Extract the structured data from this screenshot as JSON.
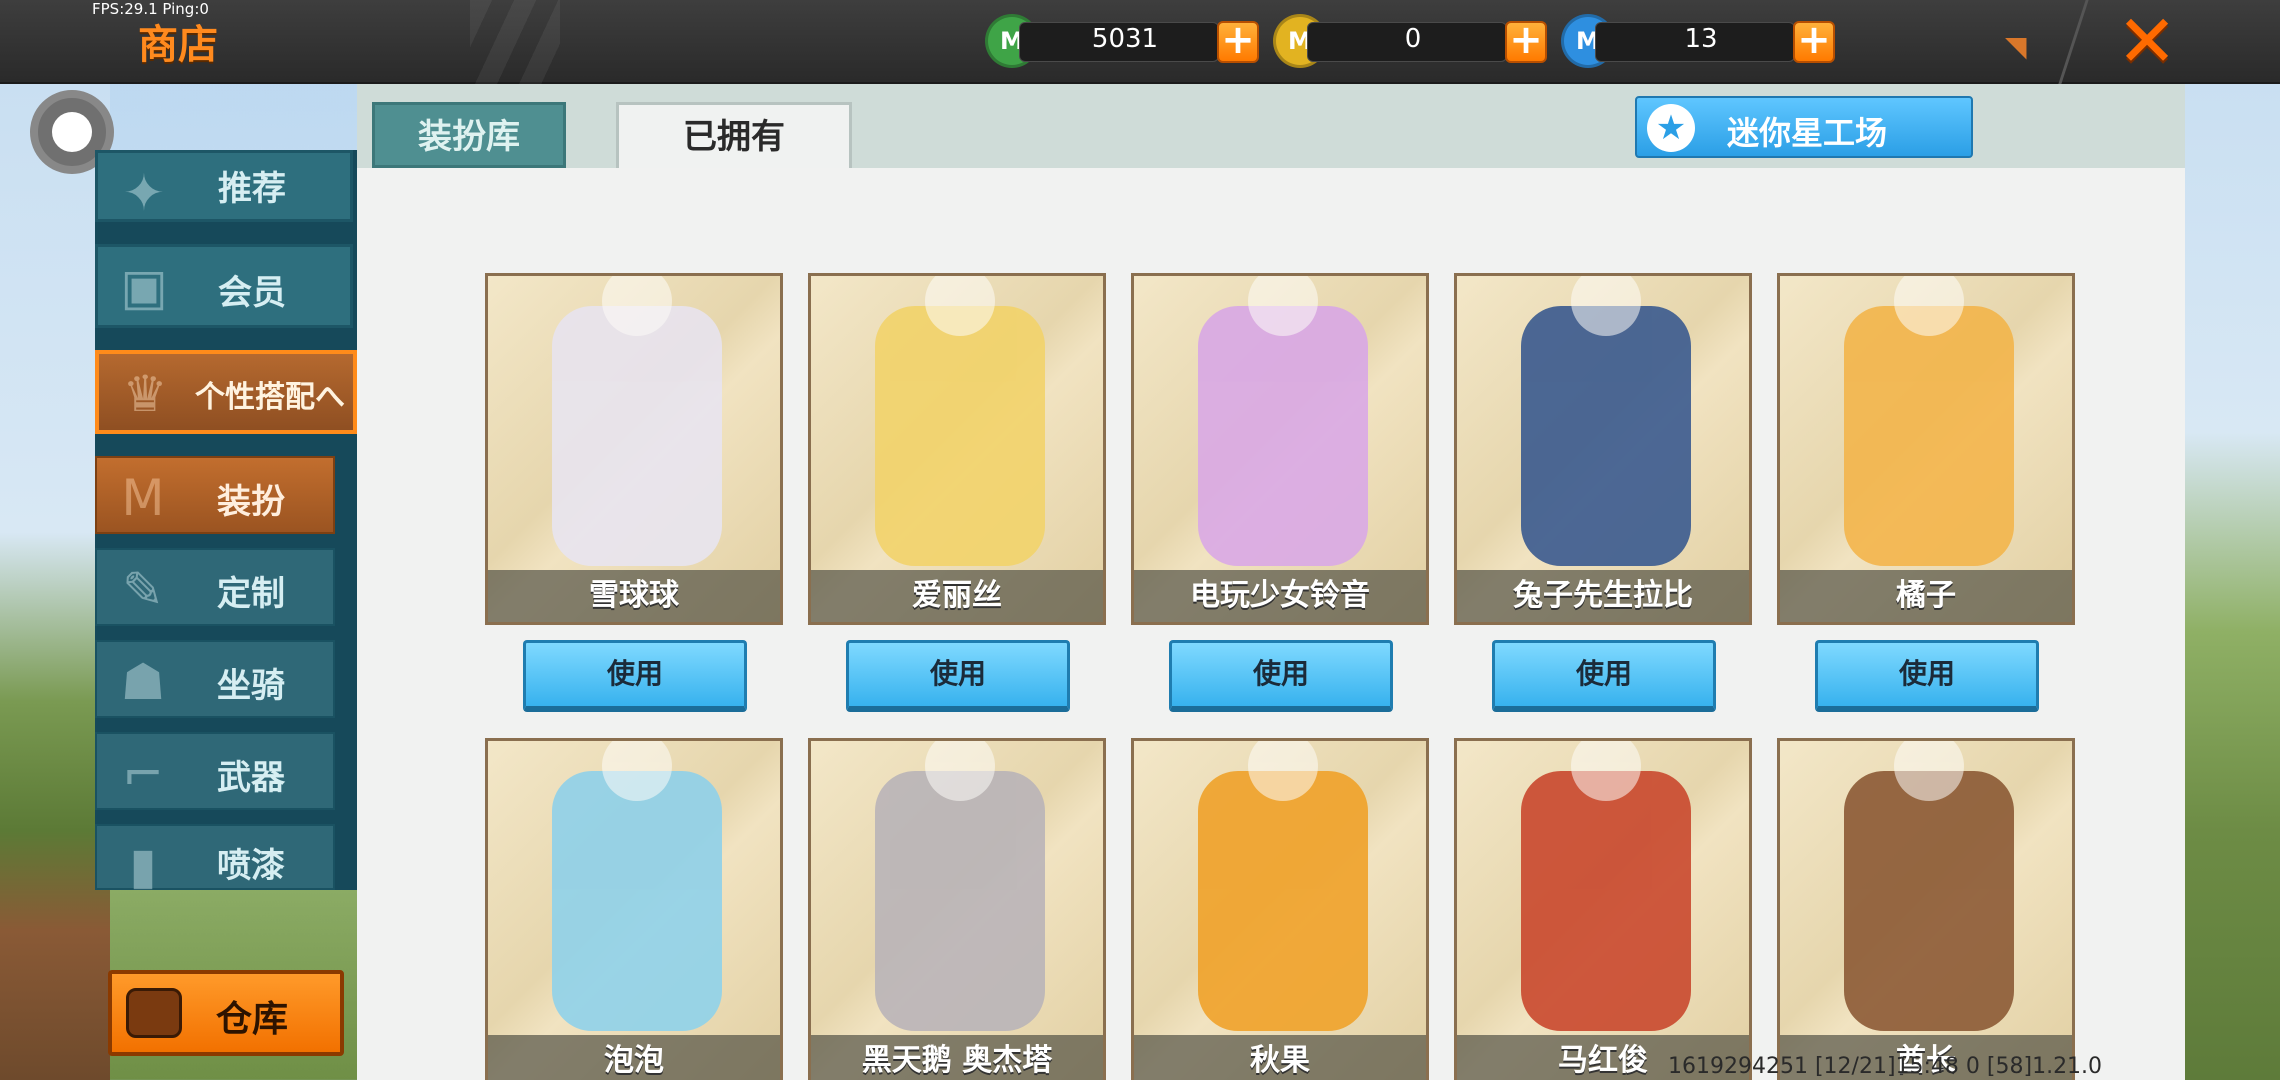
{
  "topbar": {
    "fps": "FPS:29.1  Ping:0",
    "title": "商店",
    "currencies": [
      {
        "name": "green-gem",
        "value": "5031",
        "color": "#3fa447",
        "glyph": "M"
      },
      {
        "name": "gold-coin",
        "value": "0",
        "color": "#e2b321",
        "glyph": "M"
      },
      {
        "name": "blue-coin",
        "value": "13",
        "color": "#2e8fe0",
        "glyph": "M"
      }
    ]
  },
  "sidebar": {
    "items": [
      {
        "label": "推荐"
      },
      {
        "label": "会员"
      },
      {
        "label": "个性搭配へ"
      },
      {
        "label": "装扮"
      },
      {
        "label": "定制"
      },
      {
        "label": "坐骑"
      },
      {
        "label": "武器"
      },
      {
        "label": "喷漆"
      }
    ],
    "warehouse_label": "仓库"
  },
  "tabs": [
    {
      "label": "装扮库"
    },
    {
      "label": "已拥有"
    }
  ],
  "workshop_label": "迷你星工场",
  "use_label": "使用",
  "cards": [
    {
      "name": "雪球球",
      "color": "#e8e4ef"
    },
    {
      "name": "爱丽丝",
      "color": "#f2d36a"
    },
    {
      "name": "电玩少女铃音",
      "color": "#d9a8e6"
    },
    {
      "name": "兔子先生拉比",
      "color": "#3a5a8f"
    },
    {
      "name": "橘子",
      "color": "#f3b54b"
    },
    {
      "name": "泡泡",
      "color": "#8fd1ea"
    },
    {
      "name": "黑天鹅 奥杰塔",
      "color": "#b9b4b8"
    },
    {
      "name": "秋果",
      "color": "#f0a22a"
    },
    {
      "name": "马红俊",
      "color": "#c9482e"
    },
    {
      "name": "酋长",
      "color": "#8c5a35"
    }
  ],
  "footer": "1619294251    [12/21]15:48 0    [58]1.21.0"
}
